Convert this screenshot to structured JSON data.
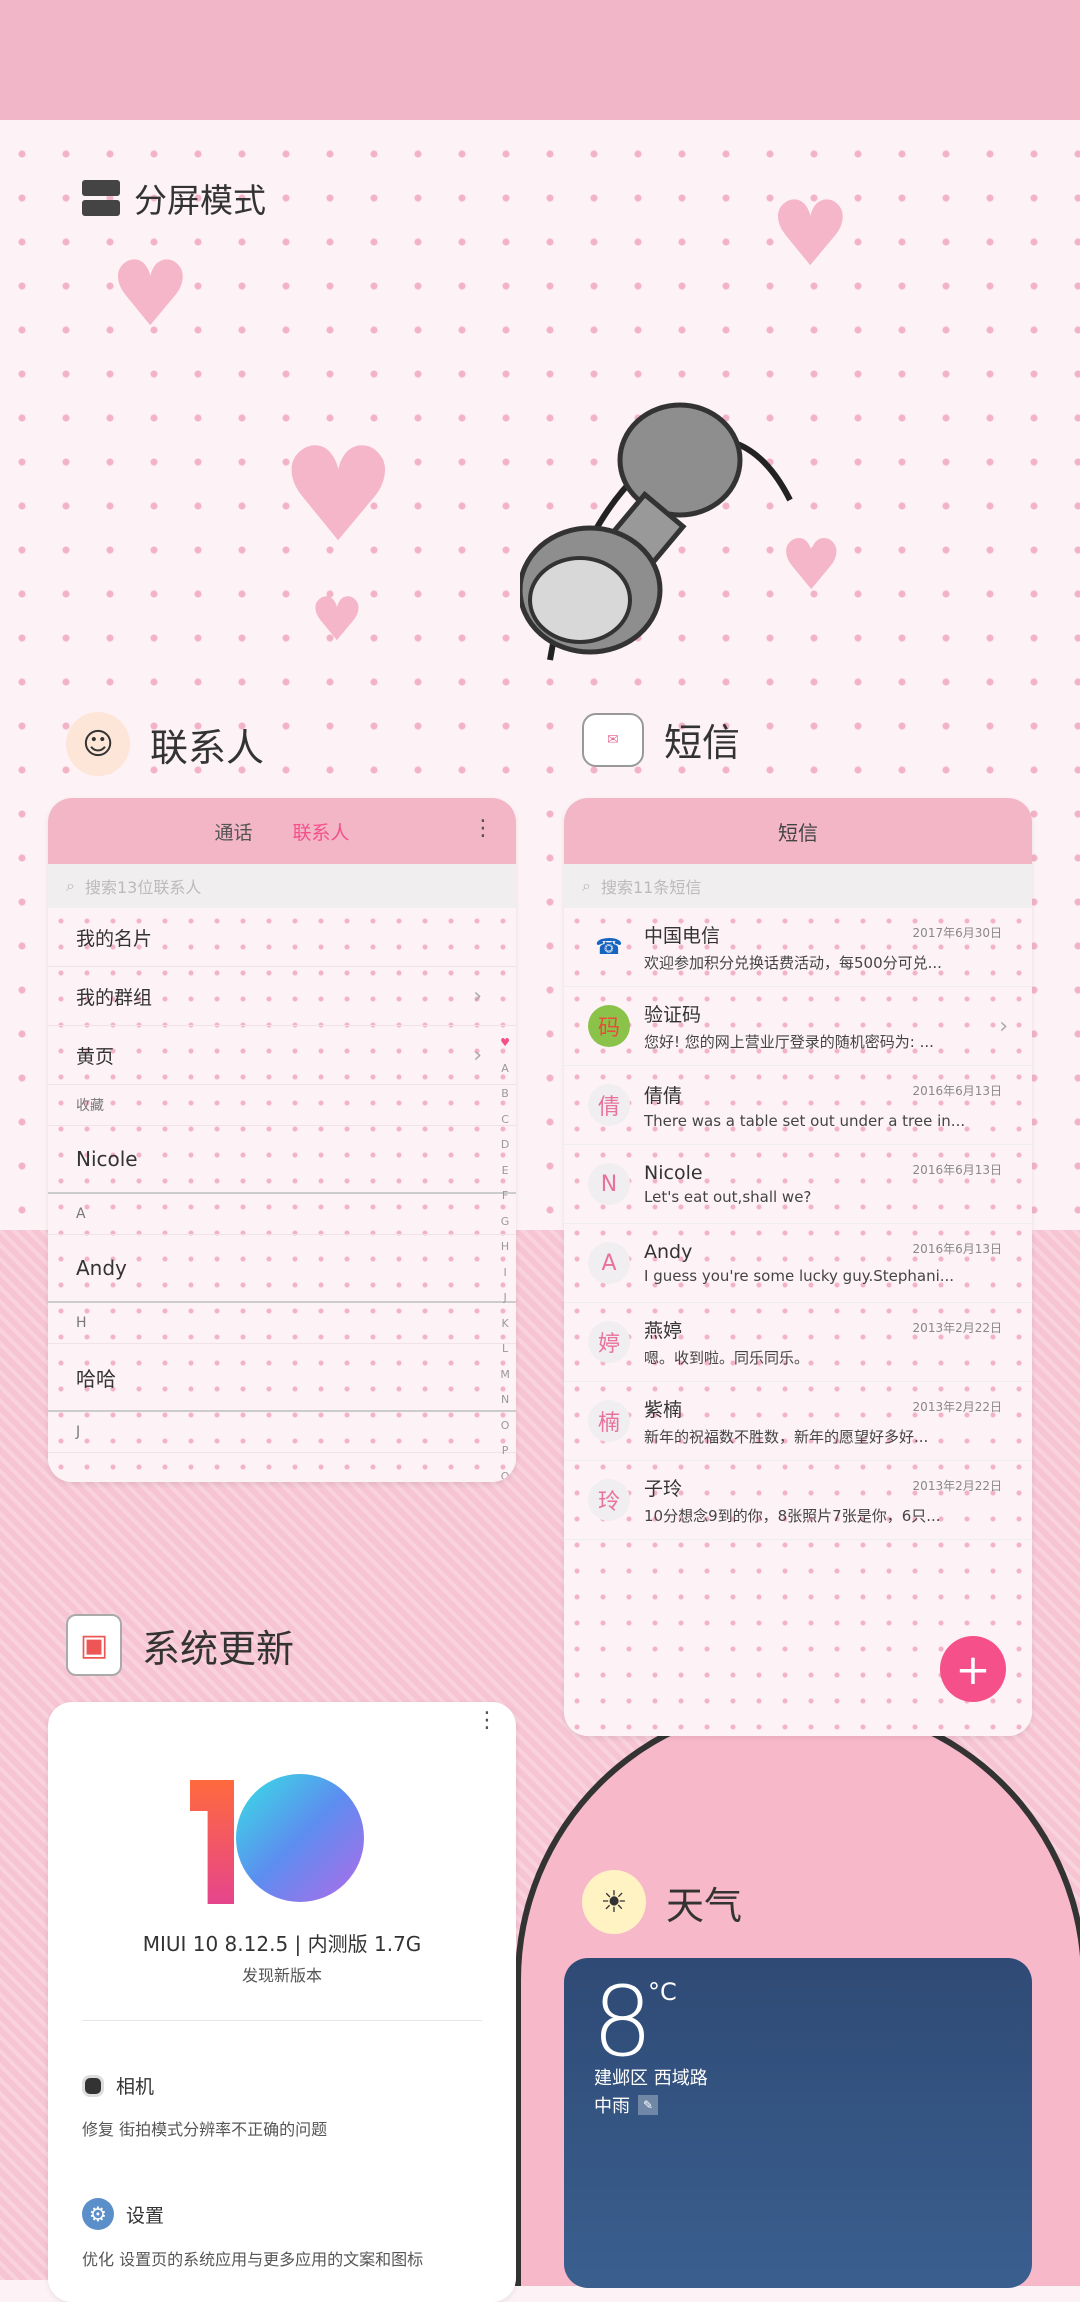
{
  "split_mode": {
    "title": "分屏模式"
  },
  "contacts_widget": {
    "title": "联系人",
    "tabs": [
      {
        "label": "通话",
        "active": false
      },
      {
        "label": "联系人",
        "active": true
      }
    ],
    "search_placeholder": "搜索13位联系人",
    "rows": [
      {
        "label": "我的名片",
        "type": "item"
      },
      {
        "label": "我的群组",
        "type": "item",
        "chevron": true
      },
      {
        "label": "黄页",
        "type": "item",
        "chevron": true
      },
      {
        "label": "收藏",
        "type": "section"
      },
      {
        "label": "Nicole",
        "type": "name"
      },
      {
        "label": "A",
        "type": "section"
      },
      {
        "label": "Andy",
        "type": "name"
      },
      {
        "label": "H",
        "type": "section"
      },
      {
        "label": "哈哈",
        "type": "name"
      },
      {
        "label": "J",
        "type": "section"
      }
    ],
    "alphabet": [
      "♥",
      "A",
      "B",
      "C",
      "D",
      "E",
      "F",
      "G",
      "H",
      "I",
      "J",
      "K",
      "L",
      "M",
      "N",
      "O",
      "P",
      "Q",
      "R",
      "S",
      "T",
      "U"
    ],
    "accent_color": "#f5508a"
  },
  "sms_widget": {
    "title": "短信",
    "header": "短信",
    "search_placeholder": "搜索11条短信",
    "messages": [
      {
        "avatar": "☎",
        "name": "中国电信",
        "date": "2017年6月30日",
        "preview": "欢迎参加积分兑换话费活动，每500分可兑..."
      },
      {
        "avatar": "码",
        "name": "验证码",
        "date": "",
        "preview": "您好! 您的网上营业厅登录的随机密码为: ..."
      },
      {
        "avatar": "倩",
        "name": "倩倩",
        "date": "2016年6月13日",
        "preview": "There was a table set out under a tree in..."
      },
      {
        "avatar": "N",
        "name": "Nicole",
        "date": "2016年6月13日",
        "preview": "Let's eat out,shall we?"
      },
      {
        "avatar": "A",
        "name": "Andy",
        "date": "2016年6月13日",
        "preview": "I guess you're some lucky guy.Stephani..."
      },
      {
        "avatar": "婷",
        "name": "燕婷",
        "date": "2013年2月22日",
        "preview": "嗯。收到啦。同乐同乐。"
      },
      {
        "avatar": "楠",
        "name": "紫楠",
        "date": "2013年2月22日",
        "preview": "新年的祝福数不胜数，新年的愿望好多好..."
      },
      {
        "avatar": "玲",
        "name": "子玲",
        "date": "2013年2月22日",
        "preview": "10分想念9到的你，8张照片7张是你，6只..."
      }
    ],
    "fab_label": "+"
  },
  "update_widget": {
    "title": "系统更新",
    "version": "MIUI 10 8.12.5 | 内测版 1.7G",
    "status": "发现新版本",
    "items": [
      {
        "name": "相机",
        "desc": "修复 街拍模式分辨率不正确的问题"
      },
      {
        "name": "设置",
        "desc": "优化 设置页的系统应用与更多应用的文案和图标"
      }
    ]
  },
  "weather_widget": {
    "title": "天气",
    "temperature": "8",
    "unit": "°C",
    "location": "建邺区  西域路",
    "condition": "中雨"
  }
}
